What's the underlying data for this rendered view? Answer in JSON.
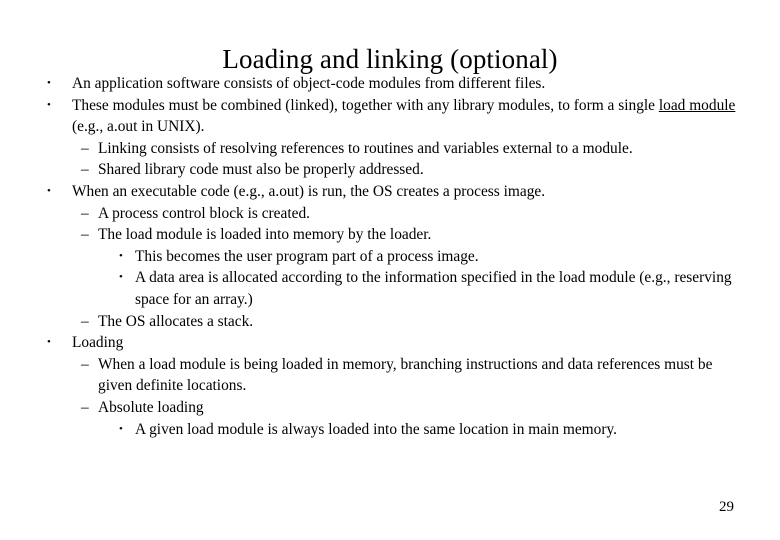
{
  "slide": {
    "title": "Loading and linking (optional)",
    "page_number": "29",
    "bullet_marker_l1": "•",
    "bullet_marker_l2": "–",
    "bullet_marker_l3": "•",
    "content": [
      {
        "level": 1,
        "text": "An application software consists of object-code modules from different files."
      },
      {
        "level": 1,
        "text_before_underline": "These modules must be combined (linked), together with any library modules, to form a single ",
        "underlined": "load module",
        "text_after_underline": " (e.g., a.out in UNIX)."
      },
      {
        "level": 2,
        "text": "Linking consists of resolving references to routines and variables external to a module."
      },
      {
        "level": 2,
        "text": "Shared library code must also be properly addressed."
      },
      {
        "level": 1,
        "text": "When an executable code (e.g., a.out) is run, the OS creates a process image."
      },
      {
        "level": 2,
        "text": "A process control block is created."
      },
      {
        "level": 2,
        "text": "The load module is loaded into memory by the loader."
      },
      {
        "level": 3,
        "text": "This becomes the user program part of a process image."
      },
      {
        "level": 3,
        "text": "A data area is allocated according to the information specified in the load module (e.g., reserving space for an array.)"
      },
      {
        "level": 2,
        "text": "The OS allocates a stack."
      },
      {
        "level": 1,
        "text": "Loading"
      },
      {
        "level": 2,
        "text": "When a load module is being loaded in memory, branching instructions and data references must be given definite locations."
      },
      {
        "level": 2,
        "text": "Absolute loading"
      },
      {
        "level": 3,
        "text": "A given load module is always loaded into the same location in main memory."
      }
    ]
  }
}
